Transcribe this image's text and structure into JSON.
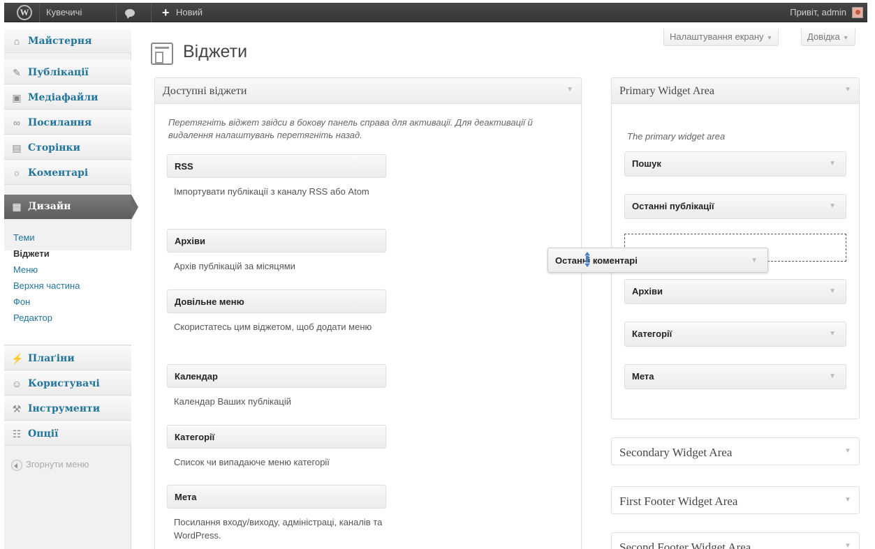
{
  "admin_bar": {
    "site_name": "Кувечичі",
    "new_label": "Новий",
    "greeting": "Привіт, admin"
  },
  "menu": {
    "items": [
      {
        "label": "Майстерня",
        "icon": "home-icon"
      },
      {
        "label": "Публікації",
        "icon": "pushpin-icon"
      },
      {
        "label": "Медіафайли",
        "icon": "media-icon"
      },
      {
        "label": "Посилання",
        "icon": "link-icon"
      },
      {
        "label": "Сторінки",
        "icon": "pages-icon"
      },
      {
        "label": "Коментарі",
        "icon": "comment-icon"
      },
      {
        "label": "Дизайн",
        "icon": "appearance-icon"
      },
      {
        "label": "Плаґіни",
        "icon": "plugin-icon"
      },
      {
        "label": "Користувачі",
        "icon": "users-icon"
      },
      {
        "label": "Інструменти",
        "icon": "tools-icon"
      },
      {
        "label": "Опції",
        "icon": "settings-icon"
      }
    ],
    "submenu": [
      "Теми",
      "Віджети",
      "Меню",
      "Верхня частина",
      "Фон",
      "Редактор"
    ],
    "collapse_label": "Згорнути меню"
  },
  "header": {
    "title": "Віджети",
    "screen_options": "Налаштування екрану",
    "help": "Довідка"
  },
  "available": {
    "title": "Доступні віджети",
    "description": "Перетягніть віджет звідси в бокову панель справа для активації. Для деактивації й видалення налаштувань перетягніть назад.",
    "widgets": [
      {
        "title": "RSS",
        "desc": "Імпортувати публікації з каналу RSS або Atom"
      },
      {
        "title": "Архіви",
        "desc": "Архів публікацій за місяцями"
      },
      {
        "title": "Довільне меню",
        "desc": "Скористатесь цим віджетом, щоб додати меню"
      },
      {
        "title": "Календар",
        "desc": "Календар Ваших публікацій"
      },
      {
        "title": "Категорії",
        "desc": "Список чи випадаюче меню категорії"
      },
      {
        "title": "Мета",
        "desc": "Посилання входу/виходу, адміністраці, каналів та WordPress."
      }
    ]
  },
  "primary": {
    "title": "Primary Widget Area",
    "description": "The primary widget area",
    "widgets": [
      "Пошук",
      "Останні публікації",
      "Архіви",
      "Категорії",
      "Мета"
    ]
  },
  "dragging_widget": "Останні коментарі",
  "other_areas": [
    "Secondary Widget Area",
    "First Footer Widget Area",
    "Second Footer Widget Area"
  ]
}
